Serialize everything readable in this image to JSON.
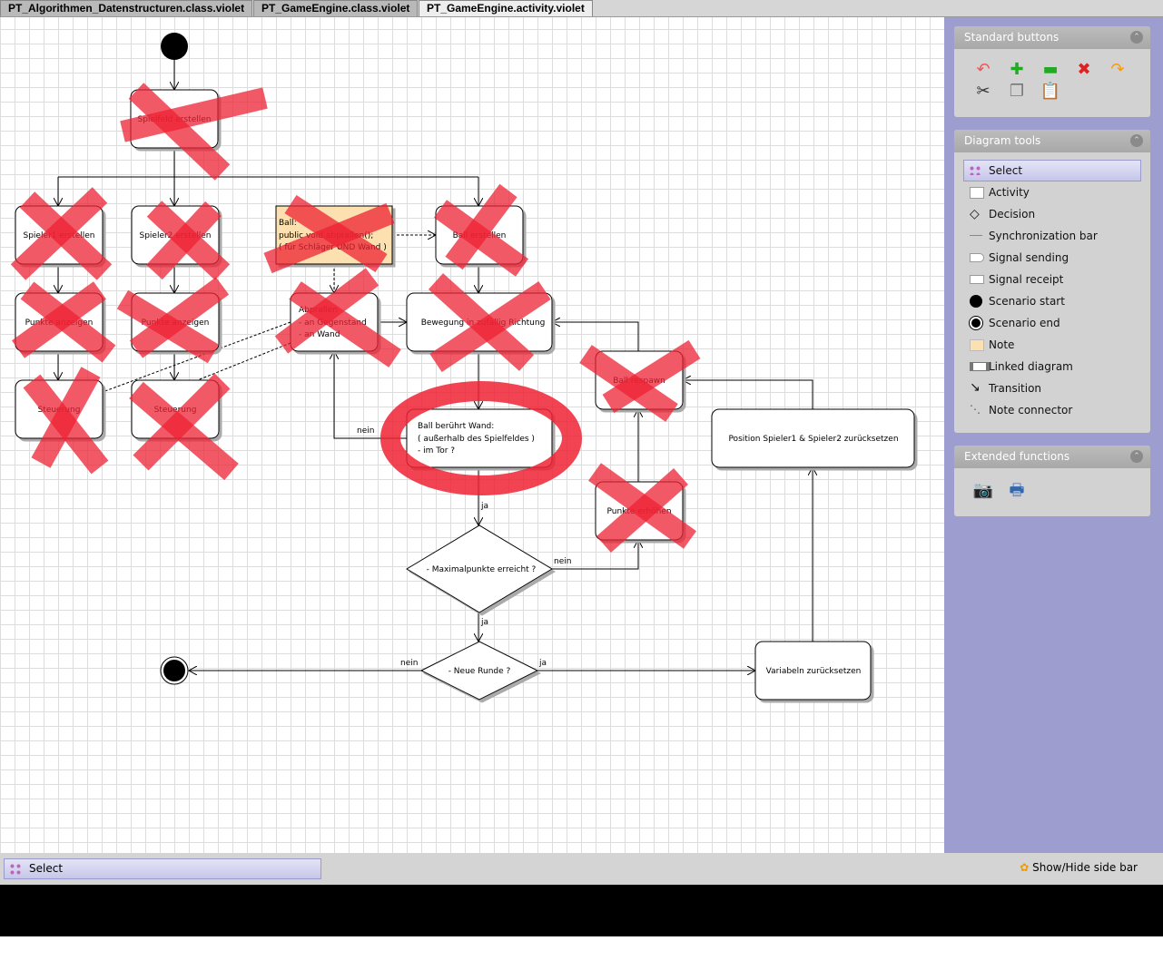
{
  "tabs": [
    {
      "label": "PT_Algorithmen_Datenstructuren.class.violet"
    },
    {
      "label": "PT_GameEngine.class.violet"
    },
    {
      "label": "PT_GameEngine.activity.violet",
      "active": true
    }
  ],
  "diagram": {
    "nodes": {
      "spielfeld": "Spielfeld erstellen",
      "spieler1": "Spieler1 erstellen",
      "spieler2": "Spieler2 erstellen",
      "note": [
        "Ball:",
        "public void abprallen();",
        "( für Schläger UND Wand )"
      ],
      "ball_erstellen": "Ball erstellen",
      "punkte1": "Punkte anzeigen",
      "punkte2": "Punkte anzeigen",
      "abprallen": [
        "Abprallen",
        "- an Gegenstand",
        "- an Wand"
      ],
      "bewegung": "Bewegung in zufällig Richtung",
      "steuerung1": "Steuerung",
      "steuerung2": "Steuerung",
      "respawn": "Ball respawn",
      "wand": [
        "Ball berührt Wand:",
        "( außerhalb des Spielfeldes )",
        "- im Tor ?"
      ],
      "position": "Position Spieler1 & Spieler2 zurücksetzen",
      "punkte_erhoehen": "Punkte erhöhen",
      "maximal": "- Maximalpunkte erreicht ?",
      "neue_runde": "- Neue Runde ?",
      "variabeln": "Variabeln zurücksetzen"
    },
    "edge_labels": {
      "nein1": "nein",
      "ja1": "ja",
      "nein2": "nein",
      "ja2": "ja",
      "nein3": "nein",
      "ja3": "ja"
    },
    "annotation_color": "#ee2233"
  },
  "sidebar": {
    "standard": {
      "title": "Standard buttons",
      "buttons": [
        "undo",
        "add",
        "remove",
        "delete",
        "redo",
        "cut",
        "copy",
        "paste"
      ]
    },
    "tools": {
      "title": "Diagram tools",
      "items": [
        {
          "label": "Select",
          "selected": true
        },
        {
          "label": "Activity"
        },
        {
          "label": "Decision"
        },
        {
          "label": "Synchronization bar"
        },
        {
          "label": "Signal sending"
        },
        {
          "label": "Signal receipt"
        },
        {
          "label": "Scenario start"
        },
        {
          "label": "Scenario end"
        },
        {
          "label": "Note"
        },
        {
          "label": "Linked diagram"
        },
        {
          "label": "Transition"
        },
        {
          "label": "Note connector"
        }
      ]
    },
    "extended": {
      "title": "Extended functions",
      "buttons": [
        "camera",
        "print"
      ]
    }
  },
  "status": {
    "tool": "Select",
    "toggle": "Show/Hide side bar"
  }
}
